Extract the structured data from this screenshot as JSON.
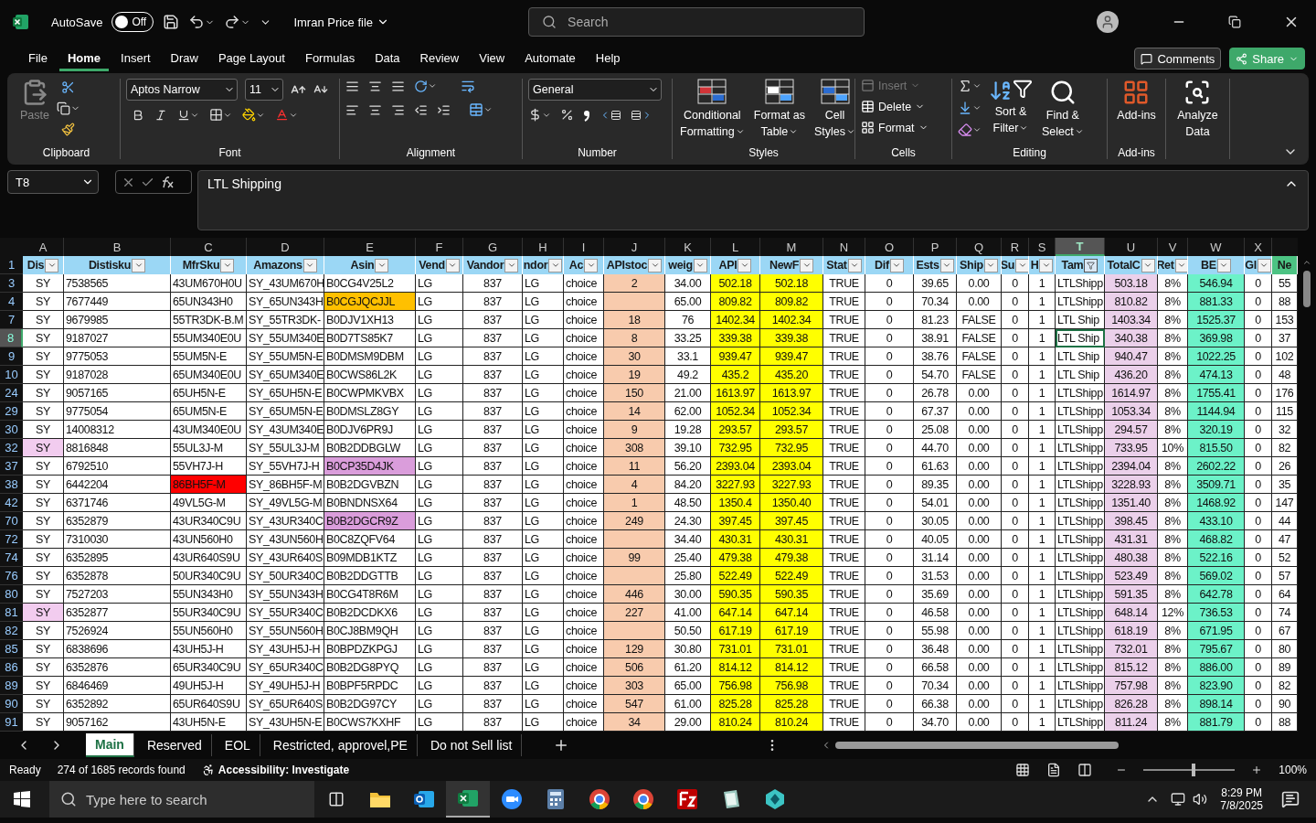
{
  "title_bar": {
    "autosave_label": "AutoSave",
    "autosave_state": "Off",
    "autosave_on": false,
    "file_name": "Imran Price file",
    "search_placeholder": "Search"
  },
  "menu": [
    {
      "label": "File",
      "selected": false
    },
    {
      "label": "Home",
      "selected": true
    },
    {
      "label": "Insert",
      "selected": false
    },
    {
      "label": "Draw",
      "selected": false
    },
    {
      "label": "Page Layout",
      "selected": false
    },
    {
      "label": "Formulas",
      "selected": false
    },
    {
      "label": "Data",
      "selected": false
    },
    {
      "label": "Review",
      "selected": false
    },
    {
      "label": "View",
      "selected": false
    },
    {
      "label": "Automate",
      "selected": false
    },
    {
      "label": "Help",
      "selected": false
    }
  ],
  "comments_button": "Comments",
  "share_button": "Share",
  "ribbon": {
    "clipboard": {
      "label": "Clipboard",
      "paste": "Paste"
    },
    "font": {
      "label": "Font",
      "font_name": "Aptos Narrow",
      "font_size": "11"
    },
    "alignment": {
      "label": "Alignment"
    },
    "number": {
      "label": "Number",
      "format": "General"
    },
    "styles": {
      "label": "Styles",
      "buttons": [
        {
          "lines": [
            "Conditional",
            "Formatting"
          ]
        },
        {
          "lines": [
            "Format as",
            "Table"
          ]
        },
        {
          "lines": [
            "Cell",
            "Styles"
          ]
        }
      ]
    },
    "cells": {
      "label": "Cells",
      "buttons": [
        {
          "label": "Insert",
          "disabled": true
        },
        {
          "label": "Delete",
          "disabled": false
        },
        {
          "label": "Format",
          "disabled": false
        }
      ]
    },
    "editing": {
      "label": "Editing",
      "buttons": [
        {
          "lines": [
            "Sort &",
            "Filter"
          ]
        },
        {
          "lines": [
            "Find &",
            "Select"
          ]
        }
      ]
    },
    "addins": {
      "label": "Add-ins",
      "button": "Add-ins"
    },
    "analyze": {
      "lines": [
        "Analyze",
        "Data"
      ]
    }
  },
  "formula_bar": {
    "name_box": "T8",
    "value": "LTL Shipping"
  },
  "sheet": {
    "columns": [
      {
        "letter": "A",
        "title": "Dis",
        "kind": "center",
        "filtered": false,
        "selected": false
      },
      {
        "letter": "B",
        "title": "Distisku",
        "kind": "text",
        "filtered": false,
        "selected": false
      },
      {
        "letter": "C",
        "title": "MfrSku",
        "kind": "text",
        "filtered": false,
        "selected": false
      },
      {
        "letter": "D",
        "title": "Amazons",
        "kind": "text",
        "filtered": false,
        "selected": false
      },
      {
        "letter": "E",
        "title": "Asin",
        "kind": "text",
        "filtered": false,
        "selected": false
      },
      {
        "letter": "F",
        "title": "Vend",
        "kind": "text",
        "filtered": false,
        "selected": false
      },
      {
        "letter": "G",
        "title": "Vandor",
        "kind": "center",
        "filtered": false,
        "selected": false
      },
      {
        "letter": "H",
        "title": "ndor",
        "kind": "text",
        "filtered": false,
        "selected": false
      },
      {
        "letter": "I",
        "title": "Ac",
        "kind": "text",
        "filtered": false,
        "selected": false
      },
      {
        "letter": "J",
        "title": "APIstoc",
        "kind": "center",
        "filtered": false,
        "selected": false,
        "color": "#f8cbad"
      },
      {
        "letter": "K",
        "title": "weig",
        "kind": "center",
        "filtered": false,
        "selected": false
      },
      {
        "letter": "L",
        "title": "API",
        "kind": "center",
        "filtered": false,
        "selected": false,
        "color": "#ffff00"
      },
      {
        "letter": "M",
        "title": "NewF",
        "kind": "center",
        "filtered": false,
        "selected": false,
        "color": "#ffff00"
      },
      {
        "letter": "N",
        "title": "Stat",
        "kind": "center",
        "filtered": false,
        "selected": false
      },
      {
        "letter": "O",
        "title": "Dif",
        "kind": "center",
        "filtered": false,
        "selected": false
      },
      {
        "letter": "P",
        "title": "Ests",
        "kind": "center",
        "filtered": false,
        "selected": false
      },
      {
        "letter": "Q",
        "title": "Ship",
        "kind": "center",
        "filtered": false,
        "selected": false
      },
      {
        "letter": "R",
        "title": "Su",
        "kind": "center",
        "filtered": false,
        "selected": false
      },
      {
        "letter": "S",
        "title": "H",
        "kind": "center",
        "filtered": false,
        "selected": false
      },
      {
        "letter": "T",
        "title": "Tam",
        "kind": "text",
        "filtered": true,
        "selected": true
      },
      {
        "letter": "U",
        "title": "TotalC",
        "kind": "center",
        "filtered": false,
        "selected": false,
        "color": "#ebd0ea"
      },
      {
        "letter": "V",
        "title": "Ret",
        "kind": "center",
        "filtered": false,
        "selected": false
      },
      {
        "letter": "W",
        "title": "BE",
        "kind": "center",
        "filtered": false,
        "selected": false,
        "color": "#6cf2c8"
      },
      {
        "letter": "X",
        "title": "Gl",
        "kind": "center",
        "filtered": false,
        "selected": false
      },
      {
        "title": "Ne",
        "kind": "accent"
      }
    ],
    "header_row": "1",
    "rows": [
      {
        "num": "3",
        "selected": false,
        "cells": [
          "SY",
          "7538565",
          "43UM670H0U",
          "SY_43UM670H",
          "B0CG4V25L2",
          "LG",
          "837",
          "LG",
          "choice",
          "2",
          "34.00",
          "502.18",
          "502.18",
          "TRUE",
          "0",
          "39.65",
          "0.00",
          "0",
          "1",
          "LTLShipp",
          "503.18",
          "8%",
          "546.94",
          "0",
          "55"
        ]
      },
      {
        "num": "4",
        "selected": false,
        "cells": [
          "SY",
          "7677449",
          "65UN343H0",
          "SY_65UN343H",
          {
            "text": "B0CGJQCJJL",
            "color": "#ffc000"
          },
          "LG",
          "837",
          "LG",
          "choice",
          "",
          "65.00",
          "809.82",
          "809.82",
          "TRUE",
          "0",
          "70.34",
          "0.00",
          "0",
          "1",
          "LTLShipp",
          "810.82",
          "8%",
          "881.33",
          "0",
          "88"
        ]
      },
      {
        "num": "7",
        "selected": false,
        "cells": [
          "SY",
          "9679985",
          "55TR3DK-B.M",
          "SY_55TR3DK-",
          "B0DJV1XH13",
          "LG",
          "837",
          "LG",
          "choice",
          "18",
          "76",
          "1402.34",
          "1402.34",
          "TRUE",
          "0",
          "81.23",
          "FALSE",
          "0",
          "1",
          "LTL Ship",
          "1403.34",
          "8%",
          "1525.37",
          "0",
          "153"
        ]
      },
      {
        "num": "8",
        "selected": true,
        "cells": [
          "SY",
          "9187027",
          "55UM340E0U",
          "SY_55UM340E",
          "B0D7TS85K7",
          "LG",
          "837",
          "LG",
          "choice",
          "8",
          "33.25",
          "339.38",
          "339.38",
          "TRUE",
          "0",
          "38.91",
          "FALSE",
          "0",
          "1",
          "LTL Ship",
          "340.38",
          "8%",
          "369.98",
          "0",
          "37"
        ]
      },
      {
        "num": "9",
        "selected": false,
        "cells": [
          "SY",
          "9775053",
          "55UM5N-E",
          "SY_55UM5N-E",
          "B0DMSM9DBM",
          "LG",
          "837",
          "LG",
          "choice",
          "30",
          "33.1",
          "939.47",
          "939.47",
          "TRUE",
          "0",
          "38.76",
          "FALSE",
          "0",
          "1",
          "LTL Ship",
          "940.47",
          "8%",
          "1022.25",
          "0",
          "102"
        ]
      },
      {
        "num": "10",
        "selected": false,
        "cells": [
          "SY",
          "9187028",
          "65UM340E0U",
          "SY_65UM340E",
          "B0CWS86L2K",
          "LG",
          "837",
          "LG",
          "choice",
          "19",
          "49.2",
          "435.2",
          "435.20",
          "TRUE",
          "0",
          "54.70",
          "FALSE",
          "0",
          "1",
          "LTL Ship",
          "436.20",
          "8%",
          "474.13",
          "0",
          "48"
        ]
      },
      {
        "num": "24",
        "selected": false,
        "cells": [
          "SY",
          "9057165",
          "65UH5N-E",
          "SY_65UH5N-E",
          "B0CWPMKVBX",
          "LG",
          "837",
          "LG",
          "choice",
          "150",
          "21.00",
          "1613.97",
          "1613.97",
          "TRUE",
          "0",
          "26.78",
          "0.00",
          "0",
          "1",
          "LTLShipp",
          "1614.97",
          "8%",
          "1755.41",
          "0",
          "176"
        ]
      },
      {
        "num": "29",
        "selected": false,
        "cells": [
          "SY",
          "9775054",
          "65UM5N-E",
          "SY_65UM5N-E",
          "B0DMSLZ8GY",
          "LG",
          "837",
          "LG",
          "choice",
          "14",
          "62.00",
          "1052.34",
          "1052.34",
          "TRUE",
          "0",
          "67.37",
          "0.00",
          "0",
          "1",
          "LTLShipp",
          "1053.34",
          "8%",
          "1144.94",
          "0",
          "115"
        ]
      },
      {
        "num": "30",
        "selected": false,
        "cells": [
          "SY",
          "14008312",
          "43UM340E0U",
          "SY_43UM340E",
          "B0DJV6PR9J",
          "LG",
          "837",
          "LG",
          "choice",
          "9",
          "19.28",
          "293.57",
          "293.57",
          "TRUE",
          "0",
          "25.08",
          "0.00",
          "0",
          "1",
          "LTLShipp",
          "294.57",
          "8%",
          "320.19",
          "0",
          "32"
        ]
      },
      {
        "num": "32",
        "selected": false,
        "cells": [
          {
            "text": "SY",
            "color": "#f2ccef"
          },
          "8816848",
          "55UL3J-M",
          "SY_55UL3J-M",
          "B0B2DDBGLW",
          "LG",
          "837",
          "LG",
          "choice",
          "308",
          "39.10",
          "732.95",
          "732.95",
          "TRUE",
          "0",
          "44.70",
          "0.00",
          "0",
          "1",
          "LTLShipp",
          "733.95",
          "10%",
          "815.50",
          "0",
          "82"
        ]
      },
      {
        "num": "37",
        "selected": false,
        "cells": [
          "SY",
          "6792510",
          "55VH7J-H",
          "SY_55VH7J-H",
          {
            "text": "B0CP35D4JK",
            "color": "#da9ddb"
          },
          "LG",
          "837",
          "LG",
          "choice",
          "11",
          "56.20",
          "2393.04",
          "2393.04",
          "TRUE",
          "0",
          "61.63",
          "0.00",
          "0",
          "1",
          "LTLShipp",
          "2394.04",
          "8%",
          "2602.22",
          "0",
          "26"
        ]
      },
      {
        "num": "38",
        "selected": false,
        "cells": [
          "SY",
          "6442204",
          {
            "text": "86BH5F-M",
            "color": "#ff0000"
          },
          "SY_86BH5F-M",
          "B0B2DGVBZN",
          "LG",
          "837",
          "LG",
          "choice",
          "4",
          "84.20",
          "3227.93",
          "3227.93",
          "TRUE",
          "0",
          "89.35",
          "0.00",
          "0",
          "1",
          "LTLShipp",
          "3228.93",
          "8%",
          "3509.71",
          "0",
          "35"
        ]
      },
      {
        "num": "42",
        "selected": false,
        "cells": [
          "SY",
          "6371746",
          "49VL5G-M",
          "SY_49VL5G-M",
          "B0BNDNSX64",
          "LG",
          "837",
          "LG",
          "choice",
          "1",
          "48.50",
          "1350.4",
          "1350.40",
          "TRUE",
          "0",
          "54.01",
          "0.00",
          "0",
          "1",
          "LTLShipp",
          "1351.40",
          "8%",
          "1468.92",
          "0",
          "147"
        ]
      },
      {
        "num": "70",
        "selected": false,
        "cells": [
          "SY",
          "6352879",
          "43UR340C9U",
          "SY_43UR340C",
          {
            "text": "B0B2DGCR9Z",
            "color": "#da9ddb"
          },
          "LG",
          "837",
          "LG",
          "choice",
          "249",
          "24.30",
          "397.45",
          "397.45",
          "TRUE",
          "0",
          "30.05",
          "0.00",
          "0",
          "1",
          "LTLShipp",
          "398.45",
          "8%",
          "433.10",
          "0",
          "44"
        ]
      },
      {
        "num": "72",
        "selected": false,
        "cells": [
          "SY",
          "7310030",
          "43UN560H0",
          "SY_43UN560H",
          "B0C8ZQFV64",
          "LG",
          "837",
          "LG",
          "choice",
          "",
          "34.40",
          "430.31",
          "430.31",
          "TRUE",
          "0",
          "40.05",
          "0.00",
          "0",
          "1",
          "LTLShipp",
          "431.31",
          "8%",
          "468.82",
          "0",
          "47"
        ]
      },
      {
        "num": "74",
        "selected": false,
        "cells": [
          "SY",
          "6352895",
          "43UR640S9U",
          "SY_43UR640S",
          "B09MDB1KTZ",
          "LG",
          "837",
          "LG",
          "choice",
          "99",
          "25.40",
          "479.38",
          "479.38",
          "TRUE",
          "0",
          "31.14",
          "0.00",
          "0",
          "1",
          "LTLShipp",
          "480.38",
          "8%",
          "522.16",
          "0",
          "52"
        ]
      },
      {
        "num": "76",
        "selected": false,
        "cells": [
          "SY",
          "6352878",
          "50UR340C9U",
          "SY_50UR340C",
          "B0B2DDGTTB",
          "LG",
          "837",
          "LG",
          "choice",
          "",
          "25.80",
          "522.49",
          "522.49",
          "TRUE",
          "0",
          "31.53",
          "0.00",
          "0",
          "1",
          "LTLShipp",
          "523.49",
          "8%",
          "569.02",
          "0",
          "57"
        ]
      },
      {
        "num": "80",
        "selected": false,
        "cells": [
          "SY",
          "7527203",
          "55UN343H0",
          "SY_55UN343H",
          "B0CG4T8R6M",
          "LG",
          "837",
          "LG",
          "choice",
          "446",
          "30.00",
          "590.35",
          "590.35",
          "TRUE",
          "0",
          "35.69",
          "0.00",
          "0",
          "1",
          "LTLShipp",
          "591.35",
          "8%",
          "642.78",
          "0",
          "64"
        ]
      },
      {
        "num": "81",
        "selected": false,
        "cells": [
          {
            "text": "SY",
            "color": "#f2ccef"
          },
          "6352877",
          "55UR340C9U",
          "SY_55UR340C",
          "B0B2DCDKX6",
          "LG",
          "837",
          "LG",
          "choice",
          "227",
          "41.00",
          "647.14",
          "647.14",
          "TRUE",
          "0",
          "46.58",
          "0.00",
          "0",
          "1",
          "LTLShipp",
          "648.14",
          "12%",
          "736.53",
          "0",
          "74"
        ]
      },
      {
        "num": "82",
        "selected": false,
        "cells": [
          "SY",
          "7526924",
          "55UN560H0",
          "SY_55UN560H",
          "B0CJ8BM9QH",
          "LG",
          "837",
          "LG",
          "choice",
          "",
          "50.50",
          "617.19",
          "617.19",
          "TRUE",
          "0",
          "55.98",
          "0.00",
          "0",
          "1",
          "LTLShipp",
          "618.19",
          "8%",
          "671.95",
          "0",
          "67"
        ]
      },
      {
        "num": "85",
        "selected": false,
        "cells": [
          "SY",
          "6838696",
          "43UH5J-H",
          "SY_43UH5J-H",
          "B0BPDZKPGJ",
          "LG",
          "837",
          "LG",
          "choice",
          "129",
          "30.80",
          "731.01",
          "731.01",
          "TRUE",
          "0",
          "36.48",
          "0.00",
          "0",
          "1",
          "LTLShipp",
          "732.01",
          "8%",
          "795.67",
          "0",
          "80"
        ]
      },
      {
        "num": "86",
        "selected": false,
        "cells": [
          "SY",
          "6352876",
          "65UR340C9U",
          "SY_65UR340C",
          "B0B2DG8PYQ",
          "LG",
          "837",
          "LG",
          "choice",
          "506",
          "61.20",
          "814.12",
          "814.12",
          "TRUE",
          "0",
          "66.58",
          "0.00",
          "0",
          "1",
          "LTLShipp",
          "815.12",
          "8%",
          "886.00",
          "0",
          "89"
        ]
      },
      {
        "num": "89",
        "selected": false,
        "cells": [
          "SY",
          "6846469",
          "49UH5J-H",
          "SY_49UH5J-H",
          "B0BPF5RPDC",
          "LG",
          "837",
          "LG",
          "choice",
          "303",
          "65.00",
          "756.98",
          "756.98",
          "TRUE",
          "0",
          "70.34",
          "0.00",
          "0",
          "1",
          "LTLShipp",
          "757.98",
          "8%",
          "823.90",
          "0",
          "82"
        ]
      },
      {
        "num": "90",
        "selected": false,
        "cells": [
          "SY",
          "6352892",
          "65UR640S9U",
          "SY_65UR640S",
          "B0B2DG97CY",
          "LG",
          "837",
          "LG",
          "choice",
          "547",
          "61.00",
          "825.28",
          "825.28",
          "TRUE",
          "0",
          "66.38",
          "0.00",
          "0",
          "1",
          "LTLShipp",
          "826.28",
          "8%",
          "898.14",
          "0",
          "90"
        ]
      },
      {
        "num": "91",
        "selected": false,
        "cells": [
          "SY",
          "9057162",
          "43UH5N-E",
          "SY_43UH5N-E",
          "B0CWS7KXHF",
          "LG",
          "837",
          "LG",
          "choice",
          "34",
          "29.00",
          "810.24",
          "810.24",
          "TRUE",
          "0",
          "34.70",
          "0.00",
          "0",
          "1",
          "LTLShipp",
          "811.24",
          "8%",
          "881.79",
          "0",
          "88"
        ]
      }
    ]
  },
  "sheet_tabs": [
    {
      "label": "Main",
      "selected": true
    },
    {
      "label": "Reserved",
      "selected": false
    },
    {
      "label": "EOL",
      "selected": false
    },
    {
      "label": "Restricted, approvel,PE",
      "selected": false
    },
    {
      "label": "Do not Sell list",
      "selected": false
    }
  ],
  "status_bar": {
    "ready": "Ready",
    "records": "274 of 1685 records found",
    "accessibility": "Accessibility: Investigate",
    "zoom": "100%",
    "zoom_slider": {
      "level": 0.55
    }
  },
  "taskbar": {
    "search_placeholder": "Type here to search",
    "time": "8:29 PM",
    "date": "7/8/2025"
  }
}
